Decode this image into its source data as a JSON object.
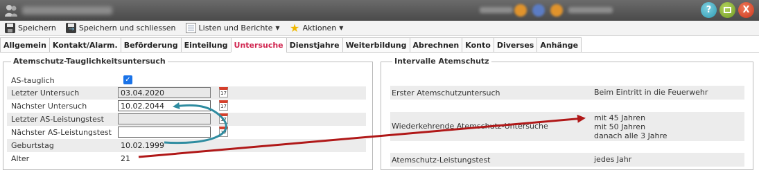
{
  "toolbar": {
    "save_label": "Speichern",
    "save_close_label": "Speichern und schliessen",
    "lists_label": "Listen und Berichte",
    "actions_label": "Aktionen"
  },
  "tabs": [
    {
      "label": "Allgemein"
    },
    {
      "label": "Kontakt/Alarm."
    },
    {
      "label": "Beförderung"
    },
    {
      "label": "Einteilung"
    },
    {
      "label": "Untersuche"
    },
    {
      "label": "Dienstjahre"
    },
    {
      "label": "Weiterbildung"
    },
    {
      "label": "Abrechnen"
    },
    {
      "label": "Konto"
    },
    {
      "label": "Diverses"
    },
    {
      "label": "Anhänge"
    }
  ],
  "active_tab": "Untersuche",
  "left_panel": {
    "title": "Atemschutz-Tauglichkeitsuntersuch",
    "as_tauglich_label": "AS-tauglich",
    "as_tauglich_checked": true,
    "letzter_untersuch_label": "Letzter Untersuch",
    "letzter_untersuch_value": "03.04.2020",
    "naechster_untersuch_label": "Nächster Untersuch",
    "naechster_untersuch_value": "10.02.2044",
    "letzter_test_label": "Letzter AS-Leistungstest",
    "letzter_test_value": "",
    "naechster_test_label": "Nächster AS-Leistungstest",
    "naechster_test_value": "",
    "geburtstag_label": "Geburtstag",
    "geburtstag_value": "10.02.1999",
    "alter_label": "Alter",
    "alter_value": "21"
  },
  "right_panel": {
    "title": "Intervalle Atemschutz",
    "rows": [
      {
        "label": "Erster Atemschutzuntersuch",
        "value": [
          "Beim Eintritt in die Feuerwehr"
        ]
      },
      {
        "label": "Wiederkehrende Atemschutz-Untersuche",
        "value": [
          "mit 45 Jahren",
          "mit 50 Jahren",
          "danach alle 3 Jahre"
        ]
      },
      {
        "label": "Atemschutz-Leistungstest",
        "value": [
          "jedes Jahr"
        ]
      }
    ]
  },
  "colors": {
    "active_tab": "#d0254f",
    "arrow_teal": "#2f8ca0",
    "arrow_red": "#b01818",
    "checkbox": "#1a73e8"
  }
}
